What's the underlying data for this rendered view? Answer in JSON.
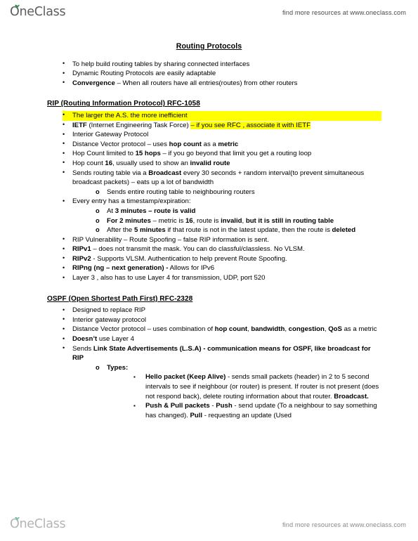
{
  "header": {
    "logo_text": "OneClass",
    "promo": "find more resources at www.oneclass.com"
  },
  "footer": {
    "logo_text": "OneClass",
    "promo": "find more resources at www.oneclass.com"
  },
  "colors": {
    "highlight": "#ffff00",
    "logo_leaf": "#2e8b57",
    "logo_gray": "#5d5d5d"
  },
  "document": {
    "title": "Routing Protocols",
    "intro_bullets": [
      {
        "plain": "To help build routing tables by sharing connected interfaces"
      },
      {
        "plain": "Dynamic Routing Protocols are easily adaptable"
      },
      {
        "bold_lead": "Convergence",
        "plain": " – When all routers have all entries(routes) from other routers"
      }
    ],
    "rip": {
      "heading": "RIP (Routing Information Protocol) RFC-1058",
      "b1_highlight": "The larger the A.S. the more inefficient",
      "b2_bold": "IETF",
      "b2_mid": " (Internet Engineering Task Force) ",
      "b2_highlight": "– if you see RFC , associate it with IETF",
      "b3": "Interior Gateway Protocol",
      "b4_a": "Distance Vector protocol – uses ",
      "b4_bold1": "hop count",
      "b4_b": " as a ",
      "b4_bold2": "metric",
      "b5_a": "Hop Count limited to ",
      "b5_bold": "15 hops",
      "b5_b": " – if you go beyond that limit you get a routing loop",
      "b6_a": "Hop count ",
      "b6_bold": "16",
      "b6_b": ", usually used to show an ",
      "b6_bold2": "invalid route",
      "b7_a": "Sends routing table via a ",
      "b7_bold": "Broadcast",
      "b7_b": " every 30 seconds + random interval(to prevent simultaneous broadcast packets) – eats up a lot of bandwidth",
      "b7_sub": "Sends entire routing table to neighbouring routers",
      "b8": "Every entry has a timestamp/expiration:",
      "b8_sub": [
        {
          "plain": "At ",
          "bold": "3 minutes – route is valid",
          "tail": ""
        },
        {
          "bold_lead": "For 2 minutes",
          "plain": " – metric is ",
          "bold2": "16",
          "plain2": ", route is ",
          "bold3": "invalid",
          "plain3": ", ",
          "bold4": "but it is still in routing table"
        },
        {
          "plain": "After the ",
          "bold": "5 minutes",
          "tail": " if that route is not in the latest update, then the route is ",
          "bold_tail": "deleted"
        }
      ],
      "b9": "RIP Vulnerability – Route Spoofing – false RIP information is sent.",
      "b10_bold": "RIPv1",
      "b10_plain": " – does not transmit the mask. You can do classful/classless. No VLSM.",
      "b11_bold": "RIPv2",
      "b11_plain": " - Supports VLSM. Authentication to help prevent Route Spoofing.",
      "b12_bold": "RIPng  (ng – next generation) -",
      "b12_plain": " Allows for IPv6",
      "b13": "Layer 3 , also has to use Layer 4 for transmission, UDP, port 520"
    },
    "ospf": {
      "heading": "OSPF (Open Shortest Path First) RFC-2328",
      "b1": "Designed to replace RIP",
      "b2": "Interior gateway protocol",
      "b3_a": "Distance Vector protocol – uses combination of ",
      "b3_bold1": "hop count",
      "b3_b": ", ",
      "b3_bold2": "bandwidth",
      "b3_c": ", ",
      "b3_bold3": "congestion",
      "b3_d": ", ",
      "b3_bold4": "QoS",
      "b3_e": "  as a metric",
      "b4_bold": "Doesn’t",
      "b4_plain": " use Layer 4",
      "b5_a": "Sends ",
      "b5_bold": "Link State Advertisements (L.S.A) - communication  means for OSPF, like broadcast for RIP",
      "b5_sub_label": "Types:",
      "types": [
        {
          "bold_lead": "Hello packet (Keep Alive)",
          "plain": " - sends small packets (header) in 2 to 5 second intervals to see if neighbour (or router) is present. If router is not present (does not respond back), delete routing information about that router. ",
          "bold_tail": "Broadcast."
        },
        {
          "bold_lead": "Push & Pull packets",
          "plain": " - ",
          "bold_mid": "Push",
          "plain2": " - send update (To a neighbour to say something has changed). ",
          "bold_mid2": "Pull",
          "plain3": " - requesting an update (Used"
        }
      ]
    }
  }
}
